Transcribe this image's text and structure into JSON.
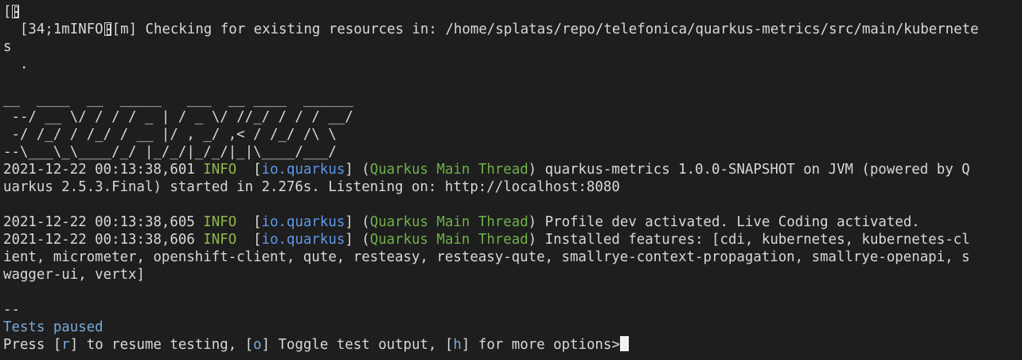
{
  "terminal": {
    "lines": {
      "l1_open": "[",
      "l2_prefix": "  [34;1mINFO",
      "l2_rest": "[m] Checking for existing resources in: /home/splatas/repo/telefonica/quarkus-metrics/src/main/kubernete",
      "l3": "s",
      "l4": "  .",
      "l5": "",
      "l6": "__  ____  __  _____   ___  __ ____  ______ ",
      "l7": " --/ __ \\/ / / / _ | / _ \\/ //_/ / / / __/ ",
      "l8": " -/ /_/ / /_/ / __ |/ , _/ ,< / /_/ /\\ \\   ",
      "l9": "--\\___\\_\\____/_/ |_/_/|_/_/|_|\\____/___/   "
    },
    "log": [
      {
        "timestamp": "2021-12-22 00:13:38,601",
        "level": "INFO ",
        "category": "io.quarkus",
        "thread": "Quarkus Main Thread",
        "message": " quarkus-metrics 1.0.0-SNAPSHOT on JVM (powered by Q",
        "continuation": "uarkus 2.5.3.Final) started in 2.276s. Listening on: http://localhost:8080"
      },
      {
        "timestamp": "2021-12-22 00:13:38,605",
        "level": "INFO ",
        "category": "io.quarkus",
        "thread": "Quarkus Main Thread",
        "message": " Profile dev activated. Live Coding activated."
      },
      {
        "timestamp": "2021-12-22 00:13:38,606",
        "level": "INFO ",
        "category": "io.quarkus",
        "thread": "Quarkus Main Thread",
        "message": " Installed features: [cdi, kubernetes, kubernetes-cl",
        "continuation": "ient, micrometer, openshift-client, qute, resteasy, resteasy-qute, smallrye-context-propagation, smallrye-openapi, s",
        "continuation2": "wagger-ui, vertx]"
      }
    ],
    "separator": "--",
    "status": "Tests paused",
    "prompt": {
      "part1": "Press [",
      "key_r": "r",
      "part2": "] to resume testing, [",
      "key_o": "o",
      "part3": "] Toggle test output, [",
      "key_h": "h",
      "part4": "] for more options>"
    }
  },
  "colors": {
    "background": "#1e1e1e",
    "text": "#d8d8d8",
    "info": "#8fb84a",
    "category": "#5e98e8",
    "thread": "#6fb04a",
    "status": "#7aa9d8"
  }
}
